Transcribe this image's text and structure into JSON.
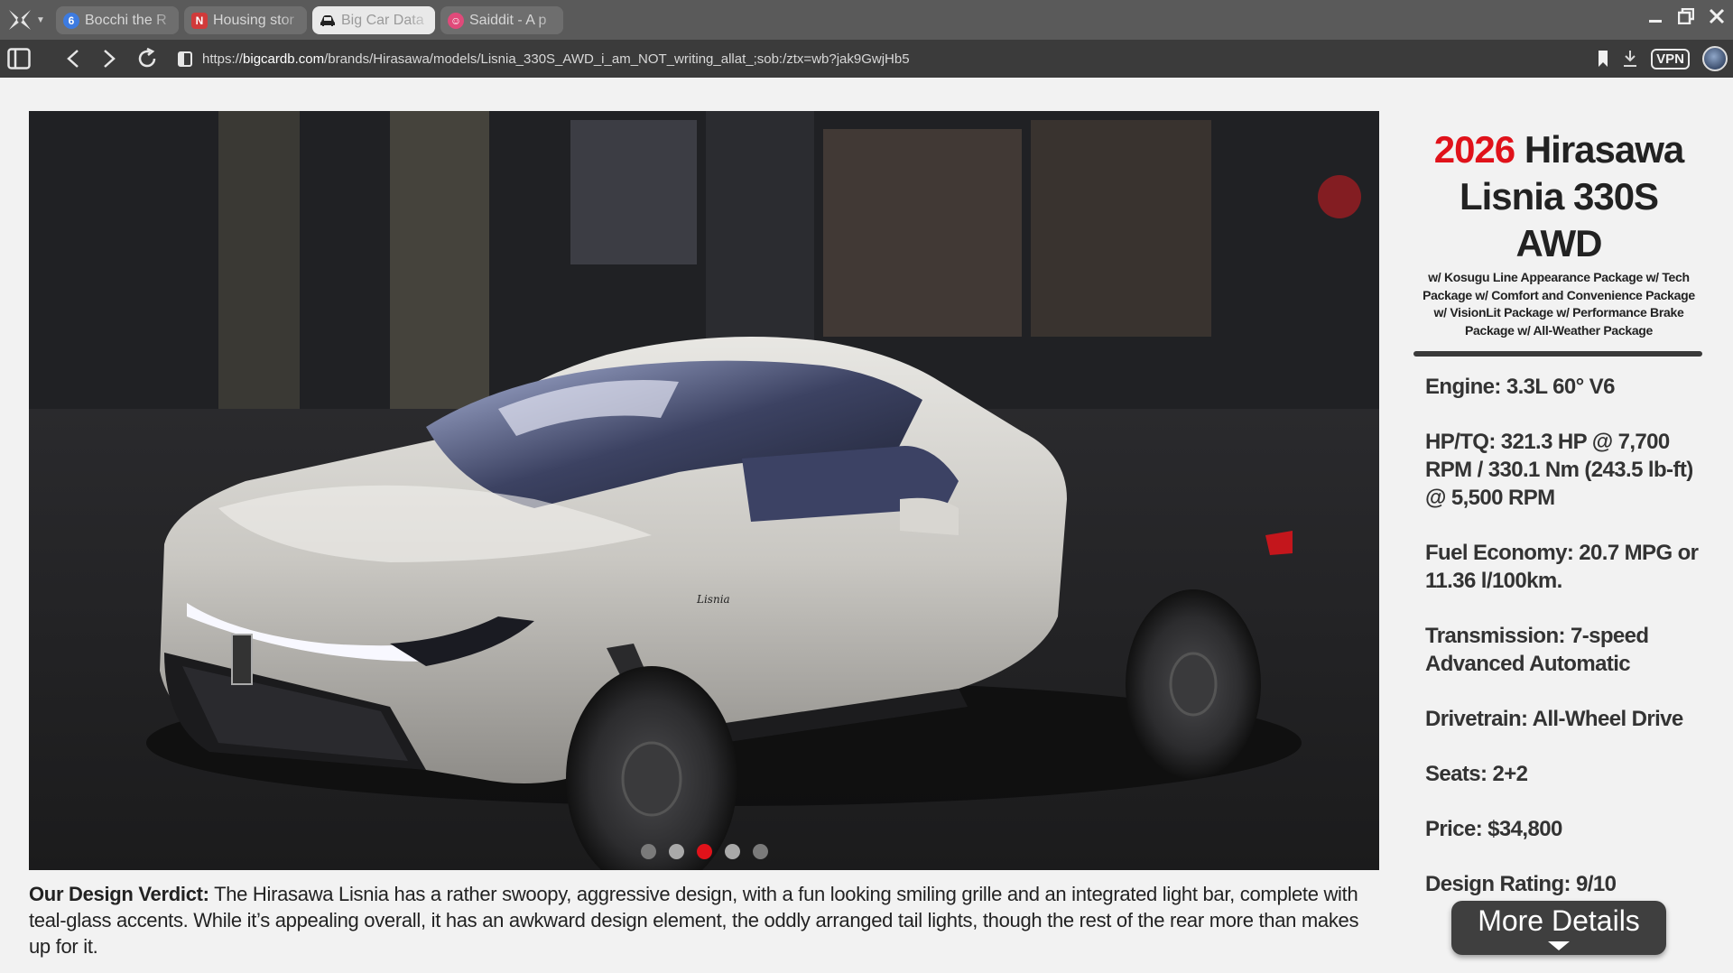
{
  "browser": {
    "tabs": [
      {
        "title": "Bocchi the R",
        "favicon": "blue-app-icon",
        "color": "#3d7be0"
      },
      {
        "title": "Housing stor",
        "favicon": "n-logo-icon",
        "color": "#d03a3a"
      },
      {
        "title": "Big Car Data",
        "favicon": "car-icon",
        "color": "#222222",
        "active": true
      },
      {
        "title": "Saiddit - A p",
        "favicon": "saiddit-icon",
        "color": "#e04a7a"
      }
    ],
    "url_prefix": "https://",
    "url_host": "bigcardb.com",
    "url_path": "/brands/Hirasawa/models/Lisnia_330S_AWD_i_am_NOT_writing_allat_;sob:/ztx=wb?jak9GwjHb5",
    "vpn_label": "VPN"
  },
  "car": {
    "year": "2026",
    "name_line1": "Hirasawa",
    "name_line2": "Lisnia 330S AWD",
    "packages": "w/ Kosugu Line Appearance Package w/ Tech Package w/ Comfort and Convenience Package w/ VisionLit Package w/ Performance Brake Package w/ All-Weather Package",
    "specs": [
      "Engine: 3.3L 60° V6",
      "HP/TQ: 321.3 HP @ 7,700 RPM / 330.1 Nm (243.5 lb-ft) @ 5,500 RPM",
      "Fuel Economy: 20.7 MPG or 11.36 l/100km.",
      "Transmission: 7-speed Advanced Automatic",
      "Drivetrain: All-Wheel Drive",
      "Seats: 2+2",
      "Price: $34,800",
      "Design Rating: 9/10"
    ],
    "more_details_label": "More Details"
  },
  "gallery": {
    "slide_count": 5,
    "active_slide": 3,
    "badge_text": "Lisnia"
  },
  "verdict": {
    "lead": "Our Design Verdict:",
    "body": " The Hirasawa Lisnia has a rather swoopy, aggressive design, with a fun looking smiling grille and an integrated light bar, complete with teal-glass accents. While it’s appealing overall, it has an awkward design element, the oddly arranged tail lights, though the rest of the rear more than makes up for it."
  },
  "colors": {
    "accent_red": "#e0121a",
    "car_body": "#c9c7c2"
  }
}
